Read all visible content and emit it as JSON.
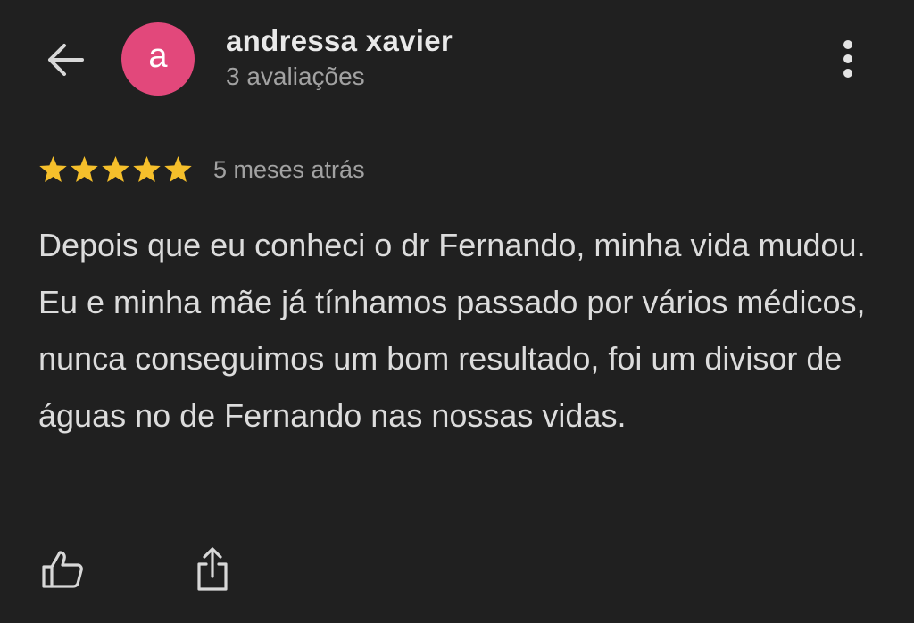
{
  "header": {
    "back_icon": "arrow-left-icon",
    "avatar_letter": "a",
    "avatar_color": "#e2487b",
    "author_name": "andressa xavier",
    "author_subtitle": "3 avaliações",
    "more_icon": "more-vertical-icon"
  },
  "review": {
    "rating": 5,
    "max_rating": 5,
    "star_color": "#f5bf2b",
    "date": "5 meses atrás",
    "text": "Depois que eu conheci o dr Fernando, minha vida mudou. Eu e minha mãe já tínhamos passado por vários médicos, nunca conseguimos um bom resultado, foi um divisor de águas no de Fernando nas nossas vidas."
  },
  "actions": {
    "like_icon": "thumbs-up-icon",
    "share_icon": "share-icon"
  },
  "colors": {
    "background": "#202020",
    "primary_text": "#e9e9e9",
    "secondary_text": "#a2a2a2"
  }
}
